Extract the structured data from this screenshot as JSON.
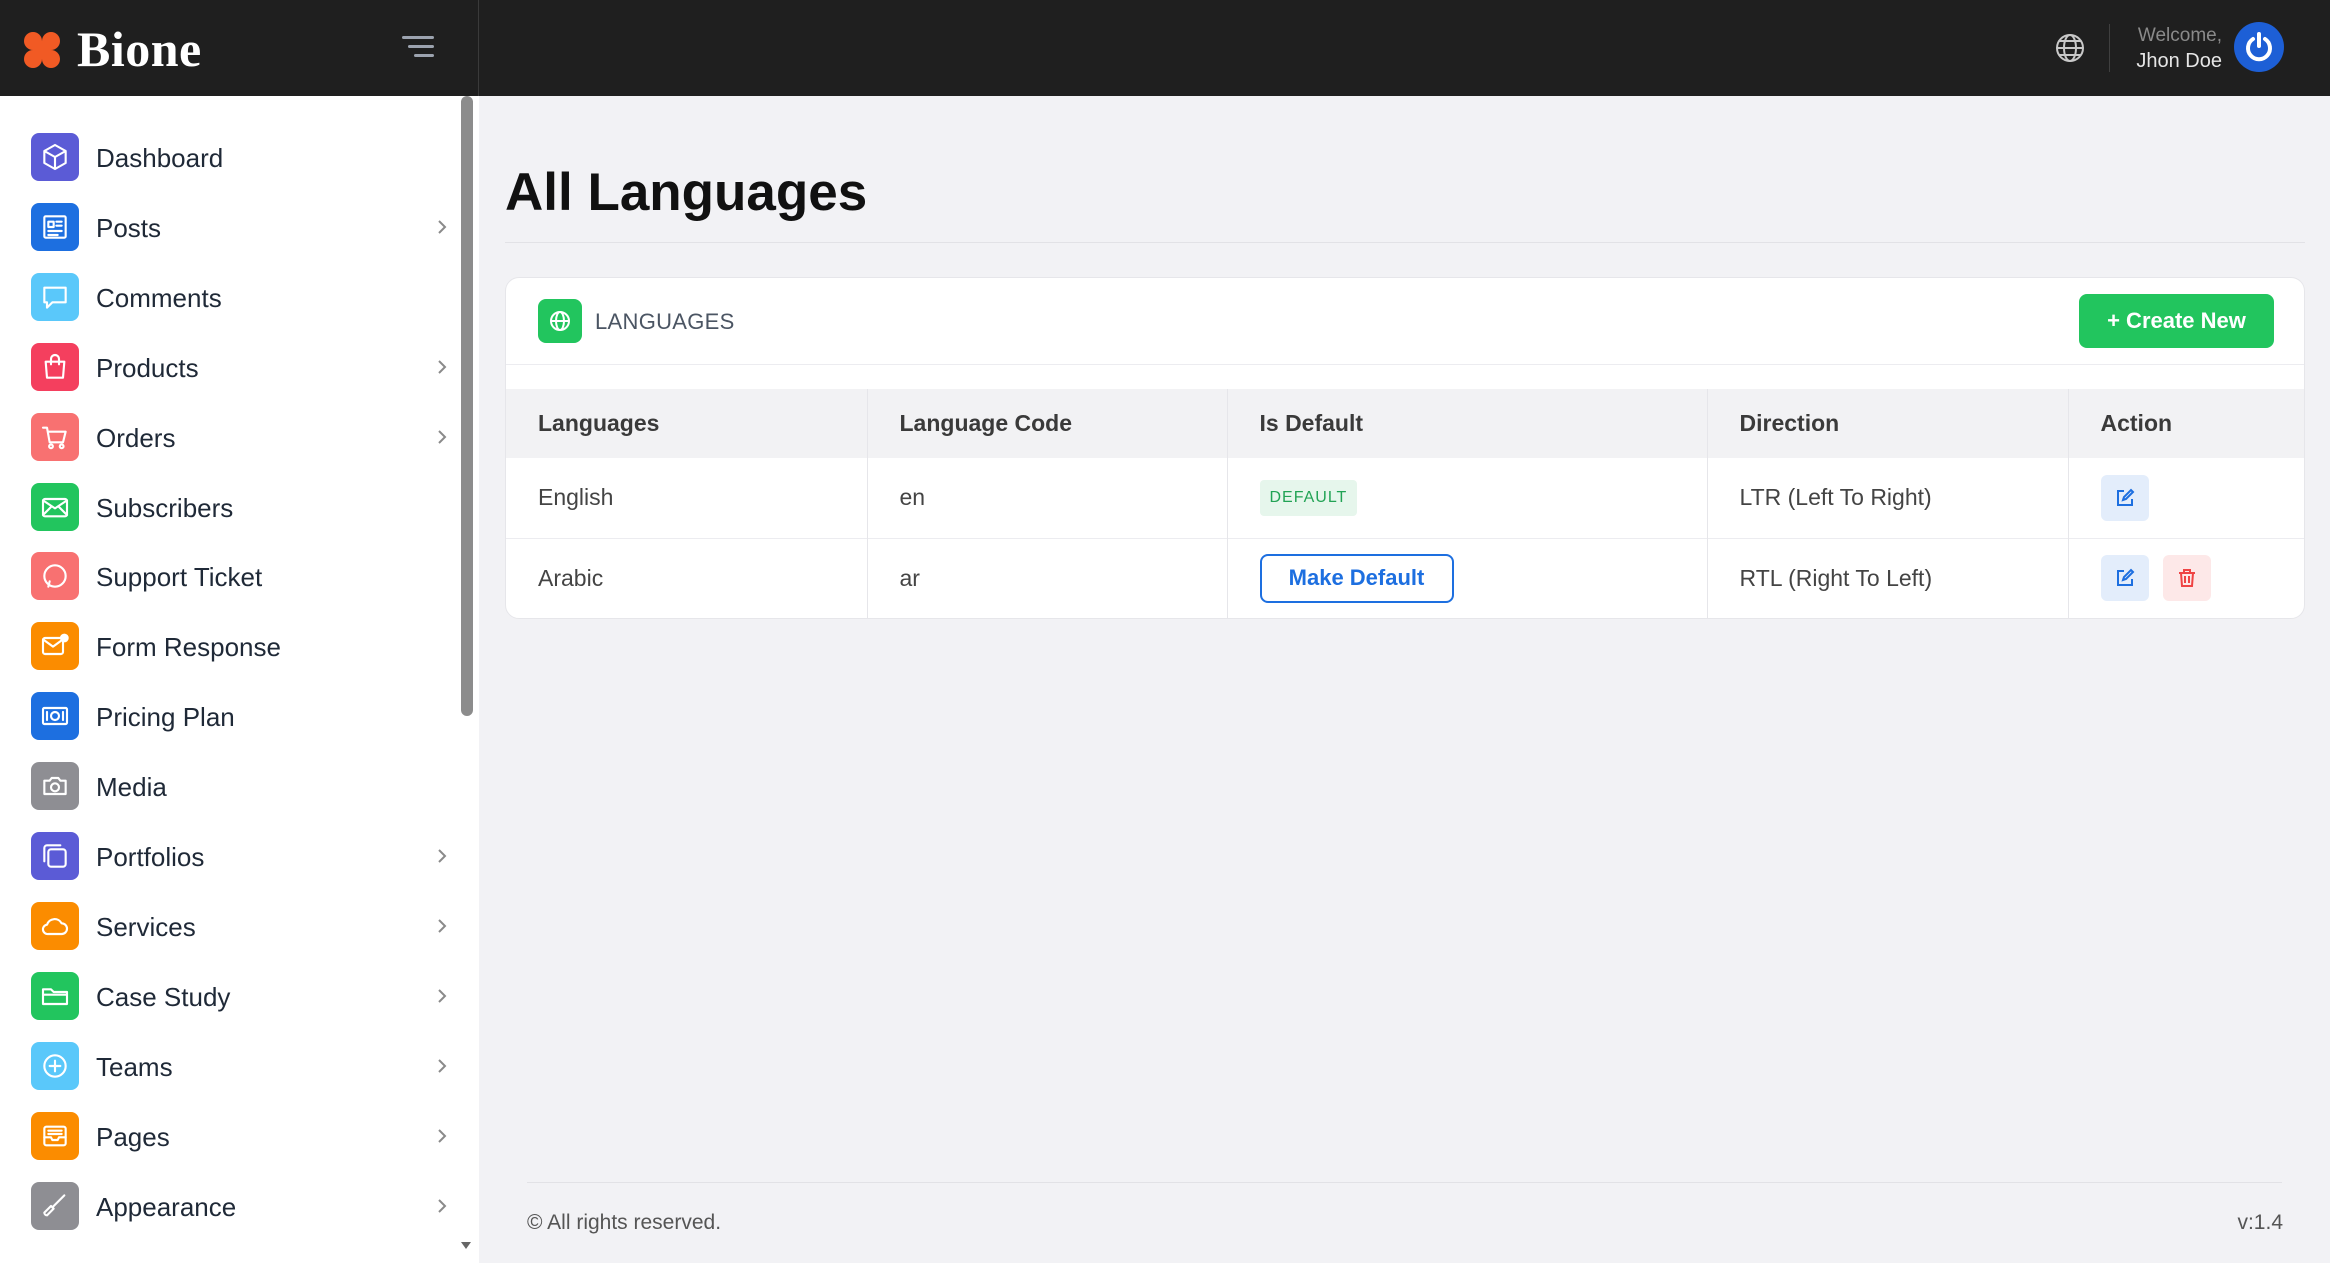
{
  "brand": {
    "name": "Bione",
    "accent": "#f15a24"
  },
  "header": {
    "welcome": "Welcome,",
    "user_name": "Jhon Doe",
    "bar_color": "#1f1f1f"
  },
  "sidebar": {
    "items": [
      {
        "label": "Dashboard",
        "icon": "cube-icon",
        "color": "#5b5bd6",
        "has_children": false
      },
      {
        "label": "Posts",
        "icon": "newspaper-icon",
        "color": "#1d6fe0",
        "has_children": true
      },
      {
        "label": "Comments",
        "icon": "chat-bubble-icon",
        "color": "#5ac8fa",
        "has_children": false
      },
      {
        "label": "Products",
        "icon": "shopping-bag-icon",
        "color": "#f43f5e",
        "has_children": true
      },
      {
        "label": "Orders",
        "icon": "cart-icon",
        "color": "#f87171",
        "has_children": true
      },
      {
        "label": "Subscribers",
        "icon": "envelope-icon",
        "color": "#22c55e",
        "has_children": false
      },
      {
        "label": "Support Ticket",
        "icon": "chat-icon",
        "color": "#f87171",
        "has_children": false
      },
      {
        "label": "Form Response",
        "icon": "mail-notification-icon",
        "color": "#fb8c00",
        "has_children": false
      },
      {
        "label": "Pricing Plan",
        "icon": "banknote-icon",
        "color": "#1d6fe0",
        "has_children": false
      },
      {
        "label": "Media",
        "icon": "camera-icon",
        "color": "#8e8e93",
        "has_children": false
      },
      {
        "label": "Portfolios",
        "icon": "copy-icon",
        "color": "#5b5bd6",
        "has_children": true
      },
      {
        "label": "Services",
        "icon": "cloud-icon",
        "color": "#fb8c00",
        "has_children": true
      },
      {
        "label": "Case Study",
        "icon": "folder-icon",
        "color": "#22c55e",
        "has_children": true
      },
      {
        "label": "Teams",
        "icon": "plus-circle-icon",
        "color": "#5ac8fa",
        "has_children": true
      },
      {
        "label": "Pages",
        "icon": "inbox-icon",
        "color": "#fb8c00",
        "has_children": true
      },
      {
        "label": "Appearance",
        "icon": "brush-icon",
        "color": "#8e8e93",
        "has_children": true
      }
    ]
  },
  "page": {
    "title": "All Languages",
    "card_title": "LANGUAGES",
    "create_label": "+ Create New"
  },
  "table": {
    "columns": [
      "Languages",
      "Language Code",
      "Is Default",
      "Direction",
      "Action"
    ],
    "rows": [
      {
        "language": "English",
        "code": "en",
        "default_badge": "DEFAULT",
        "direction": "LTR (Left To Right)"
      },
      {
        "language": "Arabic",
        "code": "ar",
        "make_default_label": "Make Default",
        "direction": "RTL (Right To Left)"
      }
    ]
  },
  "footer": {
    "copyright": "© All rights reserved.",
    "version": "v:1.4"
  }
}
